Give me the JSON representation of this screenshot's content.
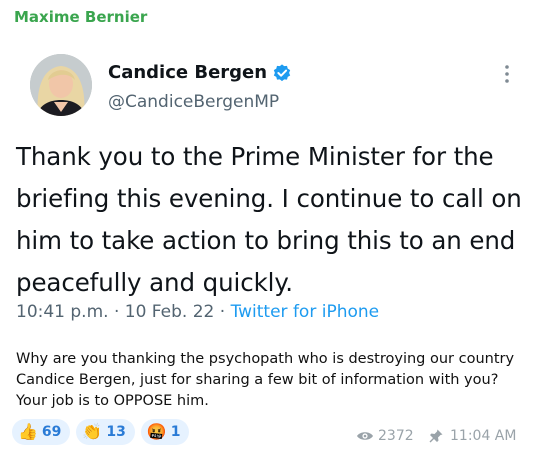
{
  "sender": "Maxime Bernier",
  "tweet": {
    "author_name": "Candice Bergen",
    "author_handle": "@CandiceBergenMP",
    "text": "Thank you to the Prime Minister for the briefing this evening. I continue to call on him to take action to bring this to an end peacefully and quickly.",
    "timestamp": "10:41 p.m. · 10 Feb. 22 · ",
    "source": "Twitter for iPhone"
  },
  "comment": "Why are you thanking the psychopath who is destroying our country Candice Bergen, just for sharing a few bit of information with you? Your job is to OPPOSE him.",
  "reactions": [
    {
      "emoji": "👍",
      "count": "69"
    },
    {
      "emoji": "👏",
      "count": "13"
    },
    {
      "emoji": "🤬",
      "count": "1"
    }
  ],
  "views": "2372",
  "time": "11:04 AM",
  "colors": {
    "sender": "#3aa54e",
    "link": "#1d9bf0",
    "verified": "#1d9bf0",
    "reaction_bg": "#e6f2ff",
    "meta": "#9aa3a9"
  },
  "icons": {
    "verified": "verified-badge-icon",
    "more": "more-vertical-icon",
    "views": "eye-icon",
    "pinned": "pin-icon"
  }
}
